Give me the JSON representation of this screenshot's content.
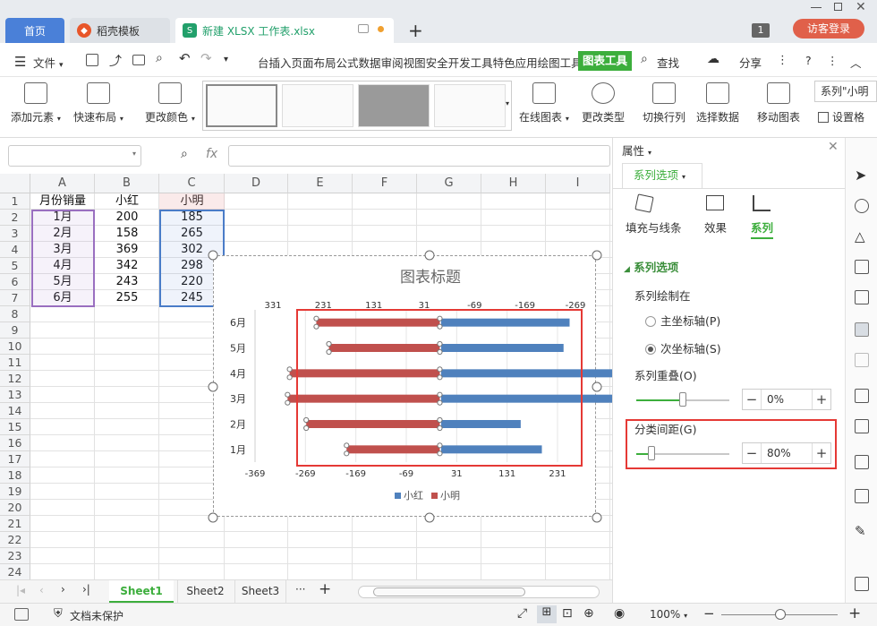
{
  "tabs": {
    "home": "首页",
    "daoke": "稻壳模板",
    "file": "新建 XLSX 工作表.xlsx",
    "page_num": "1",
    "login": "访客登录"
  },
  "menu": {
    "file": "文件",
    "items": [
      "台插入",
      "页面布局",
      "公式",
      "数据",
      "审阅",
      "视图",
      "安全",
      "开发工具",
      "特色应用",
      "绘图工具"
    ],
    "active": "图表工具",
    "search": "查找",
    "share": "分享"
  },
  "ribbon": {
    "add_element": "添加元素",
    "quick_layout": "快速布局",
    "change_color": "更改颜色",
    "online_chart": "在线图表",
    "change_type": "更改类型",
    "switch_rc": "切换行列",
    "select_data": "选择数据",
    "move_chart": "移动图表",
    "series_select": "系列\"小明",
    "set_format": "设置格"
  },
  "formula": {
    "fx": "fx",
    "name_box": "",
    "content": ""
  },
  "grid": {
    "columns": [
      "A",
      "B",
      "C",
      "D",
      "E",
      "F",
      "G",
      "H",
      "I"
    ],
    "rows": [
      "1",
      "2",
      "3",
      "4",
      "5",
      "6",
      "7",
      "8",
      "9",
      "10",
      "11",
      "12",
      "13",
      "14",
      "15",
      "16",
      "17",
      "18",
      "19",
      "20",
      "21",
      "22",
      "23",
      "24",
      "25"
    ],
    "data": [
      [
        "月份销量",
        "小红",
        "小明"
      ],
      [
        "1月",
        "200",
        "185"
      ],
      [
        "2月",
        "158",
        "265"
      ],
      [
        "3月",
        "369",
        "302"
      ],
      [
        "4月",
        "342",
        "298"
      ],
      [
        "5月",
        "243",
        "220"
      ],
      [
        "6月",
        "255",
        "245"
      ]
    ]
  },
  "chart_data": {
    "type": "bar",
    "title": "图表标题",
    "categories": [
      "1月",
      "2月",
      "3月",
      "4月",
      "5月",
      "6月"
    ],
    "series": [
      {
        "name": "小红",
        "values": [
          200,
          158,
          369,
          342,
          243,
          255
        ],
        "color": "#4f81bd",
        "axis": "primary"
      },
      {
        "name": "小明",
        "values": [
          185,
          265,
          302,
          298,
          220,
          245
        ],
        "color": "#c0504d",
        "axis": "secondary"
      }
    ],
    "primary_axis_ticks": [
      "-369",
      "-269",
      "-169",
      "-69",
      "31",
      "131",
      "231"
    ],
    "secondary_axis_ticks": [
      "331",
      "231",
      "131",
      "31",
      "-69",
      "-169",
      "-269"
    ],
    "legend": "bottom"
  },
  "sheets": {
    "active": "Sheet1",
    "others": [
      "Sheet2",
      "Sheet3"
    ],
    "more": "···"
  },
  "panel": {
    "title": "属性",
    "tab": "系列选项",
    "subtabs": [
      "填充与线条",
      "效果",
      "系列"
    ],
    "section": "系列选项",
    "plot_on": "系列绘制在",
    "primary_axis": "主坐标轴(P)",
    "secondary_axis": "次坐标轴(S)",
    "overlap_label": "系列重叠(O)",
    "overlap_value": "0%",
    "overlap": 0,
    "gap_label": "分类间距(G)",
    "gap_value": "80%",
    "gap": 80
  },
  "status": {
    "protect": "文档未保护",
    "zoom": "100%"
  },
  "colors": {
    "accent": "#3cae3c",
    "blue": "#4f81bd",
    "red": "#c0504d",
    "highlight": "#e53935"
  }
}
